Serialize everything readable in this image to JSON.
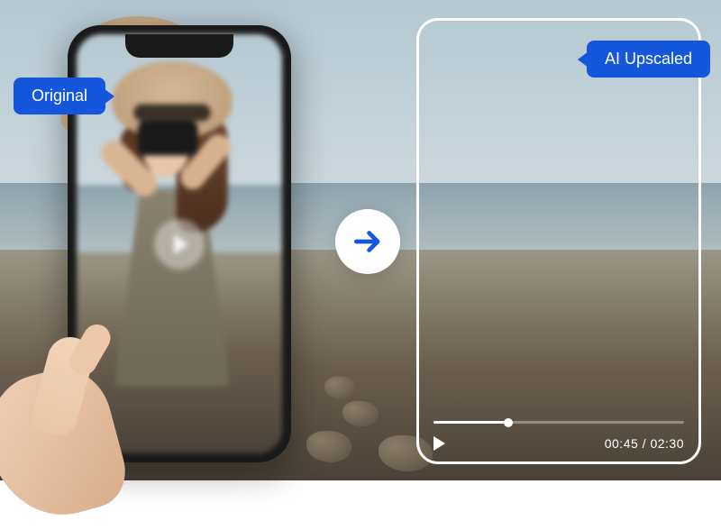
{
  "labels": {
    "original": "Original",
    "upscaled": "AI Upscaled"
  },
  "video": {
    "current_time": "00:45",
    "total_time": "02:30",
    "separator": " / "
  },
  "colors": {
    "accent": "#1557dc",
    "frame": "#ffffff"
  },
  "icons": {
    "play": "play-icon",
    "arrow": "arrow-right-icon"
  }
}
